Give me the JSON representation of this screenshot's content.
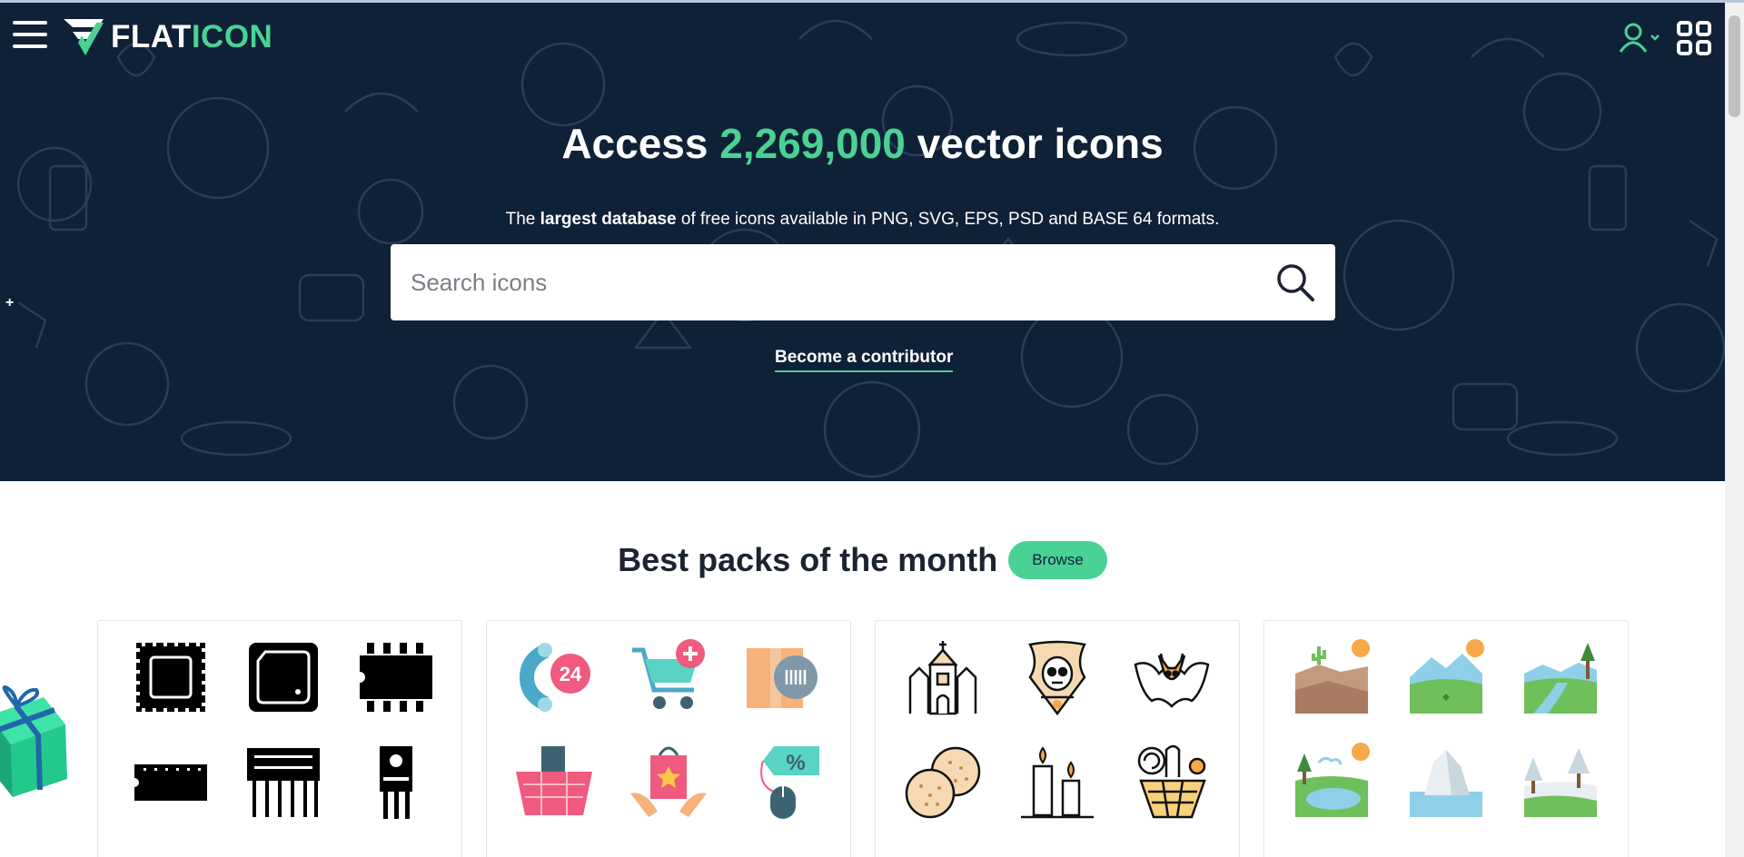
{
  "header": {
    "logo": {
      "text_white": "FLAT",
      "text_green": "ICON"
    },
    "menu_icon": "hamburger-menu-icon",
    "user_icon": "user-icon",
    "apps_icon": "apps-grid-icon"
  },
  "hero": {
    "headline_prefix": "Access",
    "headline_count": "2,269,000",
    "headline_suffix": "vector icons",
    "sub_pre": "The",
    "sub_bold": "largest database",
    "sub_post": "of free icons available in PNG, SVG, EPS, PSD and BASE 64 formats.",
    "search_placeholder": "Search icons",
    "contributor_link": "Become a contributor",
    "plus_mark": "+"
  },
  "packs": {
    "title": "Best packs of the month",
    "browse_label": "Browse",
    "cards": [
      {
        "style": "glyph",
        "icons": [
          "chip-square-icon",
          "cpu-chip-icon",
          "dip-chip-icon",
          "dip-strip-icon",
          "transistor-array-icon",
          "voltage-regulator-icon"
        ]
      },
      {
        "style": "flat",
        "icons": [
          "phone-24h-icon",
          "add-to-cart-icon",
          "barcode-box-icon",
          "shopping-basket-icon",
          "gift-bag-hands-icon",
          "mouse-discount-tag-icon"
        ]
      },
      {
        "style": "lineal-color",
        "icons": [
          "haunted-house-icon",
          "grim-reaper-icon",
          "bat-icon",
          "cookies-icon",
          "candles-icon",
          "candy-basket-icon"
        ]
      },
      {
        "style": "flat-landscape",
        "icons": [
          "desert-landscape-icon",
          "mountain-landscape-icon",
          "river-valley-icon",
          "lake-landscape-icon",
          "iceberg-icon",
          "snowy-forest-icon"
        ]
      }
    ]
  },
  "colors": {
    "hero_bg": "#0f2137",
    "accent": "#4ad295",
    "title": "#1c2331"
  }
}
